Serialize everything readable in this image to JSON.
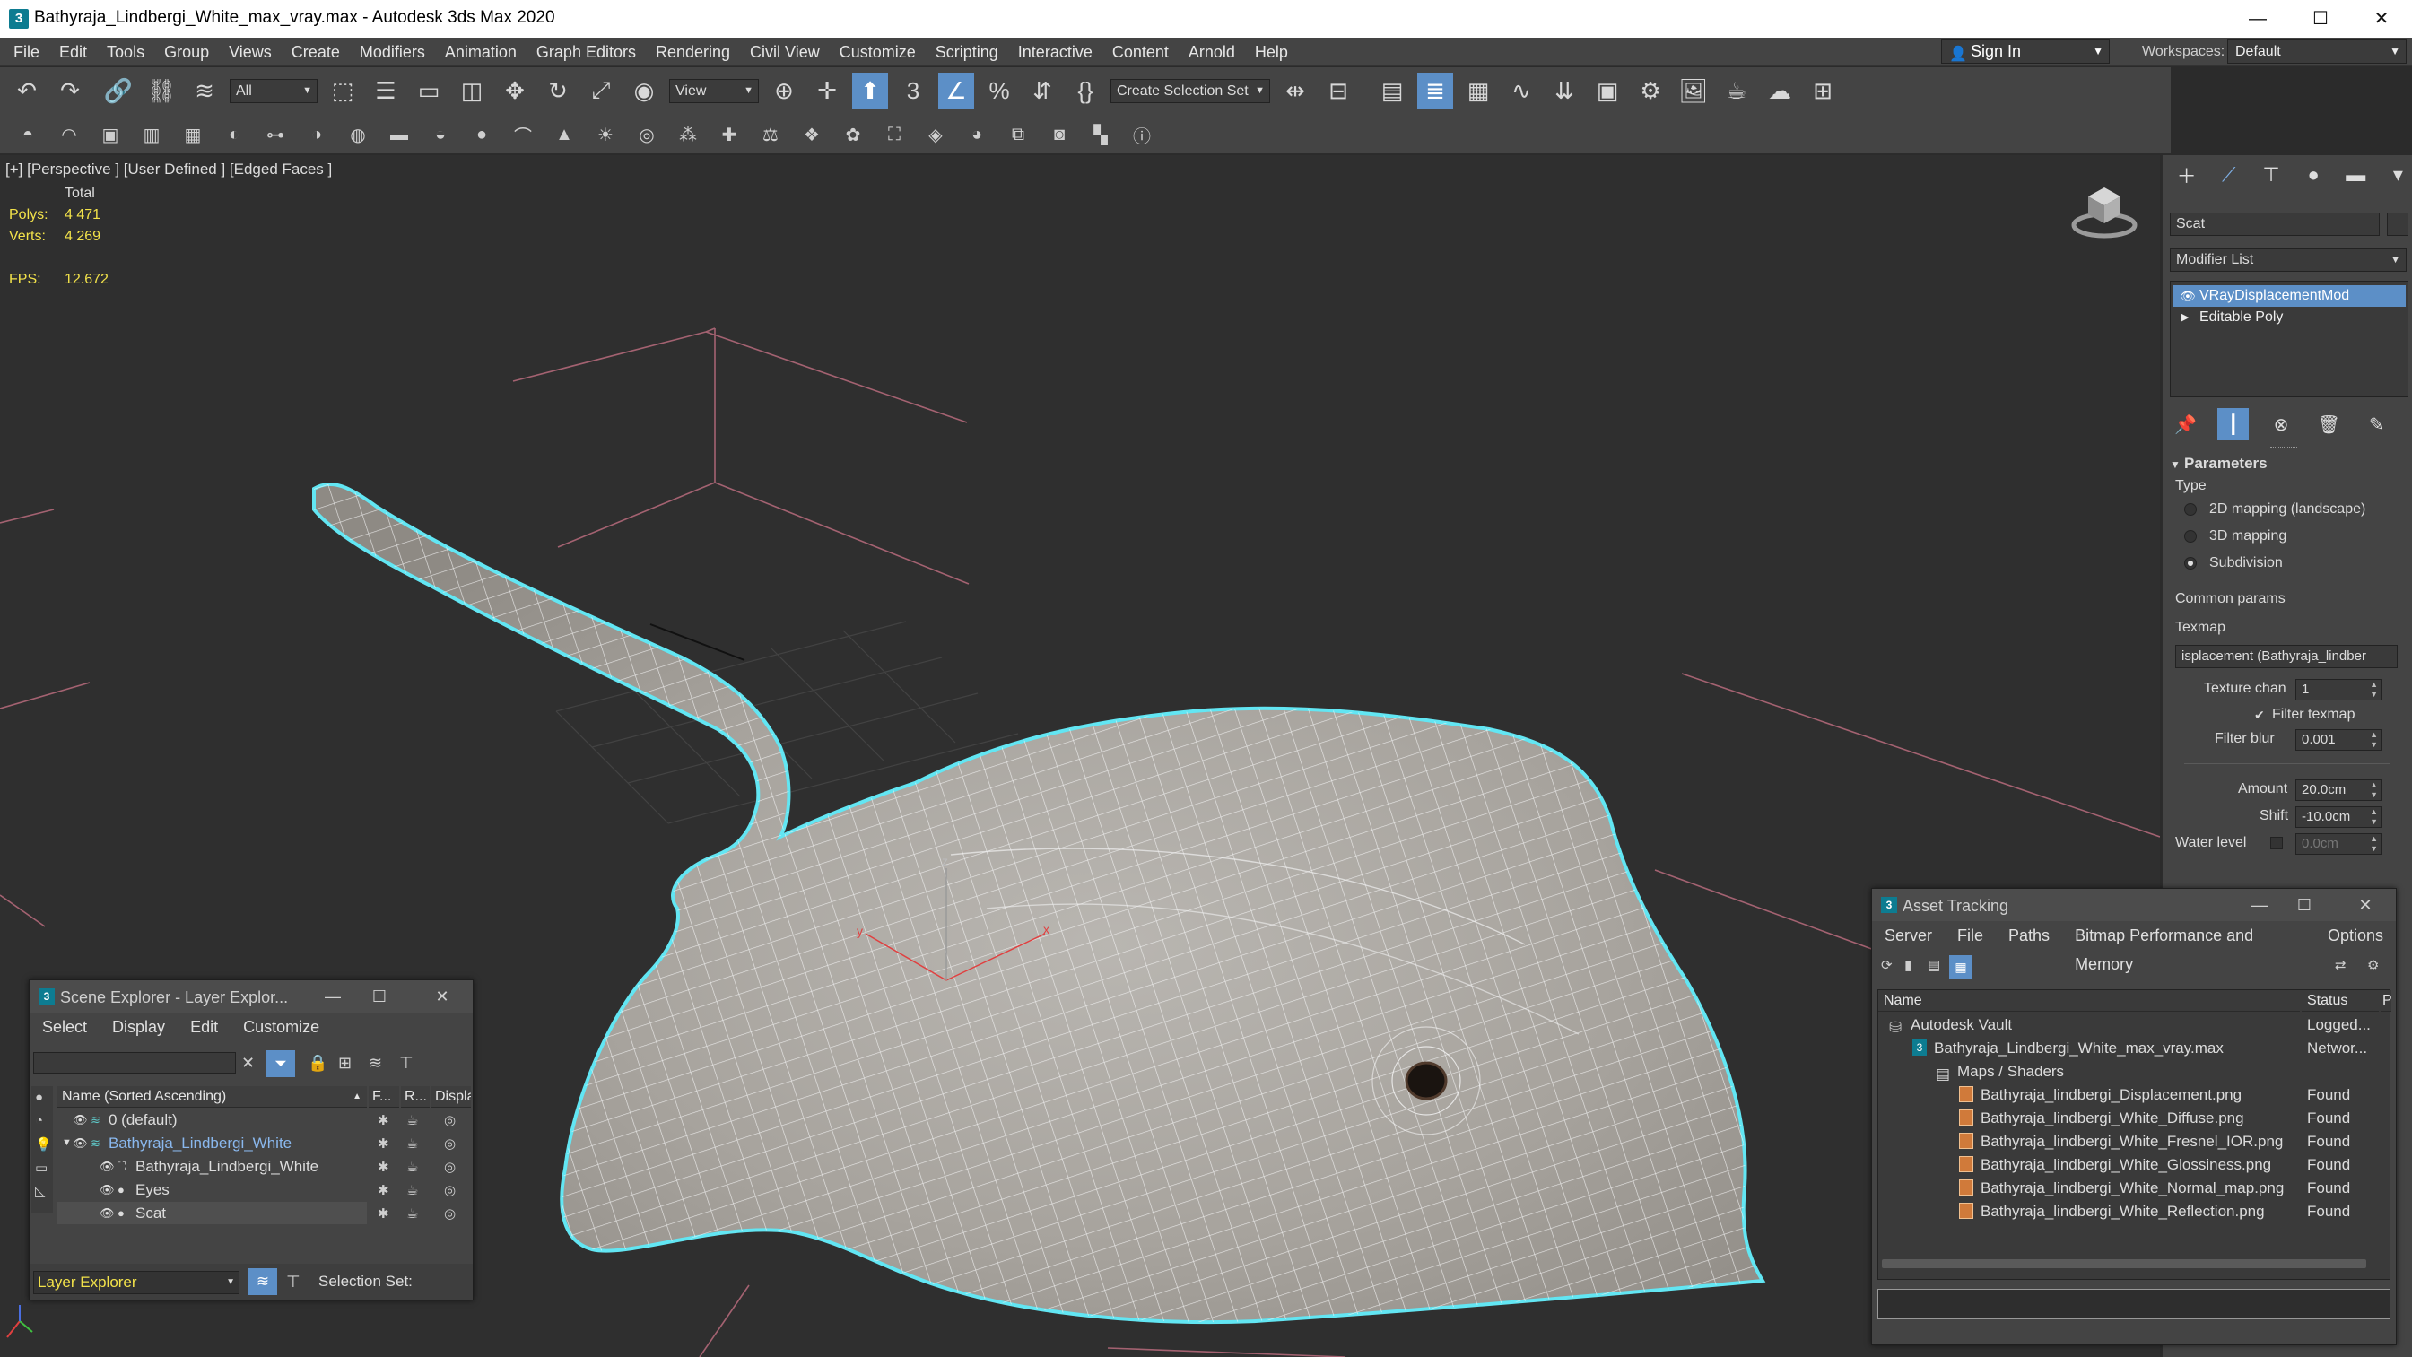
{
  "window": {
    "app_icon": "3",
    "title": "Bathyraja_Lindbergi_White_max_vray.max - Autodesk 3ds Max 2020",
    "minimize": "—",
    "maximize": "☐",
    "close": "✕"
  },
  "menubar": {
    "items": [
      "File",
      "Edit",
      "Tools",
      "Group",
      "Views",
      "Create",
      "Modifiers",
      "Animation",
      "Graph Editors",
      "Rendering",
      "Civil View",
      "Customize",
      "Scripting",
      "Interactive",
      "Content",
      "Arnold",
      "Help"
    ],
    "signin_label": "Sign In",
    "workspaces_label": "Workspaces:",
    "workspace_value": "Default"
  },
  "toolbar": {
    "selection_filter": "All",
    "ref_coord": "View",
    "create_selection_set": "Create Selection Set"
  },
  "viewport": {
    "label": "[+] [Perspective ] [User Defined ] [Edged Faces ]",
    "stats": {
      "header": "Total",
      "polys_label": "Polys:",
      "polys_value": "4 471",
      "verts_label": "Verts:",
      "verts_value": "4 269",
      "fps_label": "FPS:",
      "fps_value": "12.672"
    },
    "gizmo": {
      "x": "x",
      "y": "y",
      "z": "z"
    }
  },
  "command_panel": {
    "object_name": "Scat",
    "modifier_list": "Modifier List",
    "stack": [
      {
        "label": "VRayDisplacementMod",
        "selected": true
      },
      {
        "label": "Editable Poly",
        "selected": false
      }
    ],
    "parameters": {
      "rollout_title": "Parameters",
      "type_label": "Type",
      "type_options": [
        {
          "label": "2D mapping (landscape)",
          "checked": false
        },
        {
          "label": "3D mapping",
          "checked": false
        },
        {
          "label": "Subdivision",
          "checked": true
        }
      ],
      "common_params": "Common params",
      "texmap_label": "Texmap",
      "texmap_value": "isplacement (Bathyraja_lindber",
      "texture_chan_label": "Texture chan",
      "texture_chan_value": "1",
      "filter_texmap_label": "Filter texmap",
      "filter_blur_label": "Filter blur",
      "filter_blur_value": "0.001",
      "amount_label": "Amount",
      "amount_value": "20.0cm",
      "shift_label": "Shift",
      "shift_value": "-10.0cm",
      "water_level_label": "Water level",
      "water_level_value": "0.0cm"
    }
  },
  "scene_explorer": {
    "title": "Scene Explorer - Layer Explor...",
    "menu": [
      "Select",
      "Display",
      "Edit",
      "Customize"
    ],
    "columns": [
      "Name (Sorted Ascending)",
      "F...",
      "R...",
      "Display..."
    ],
    "rows": [
      {
        "name": "0 (default)",
        "level": 0
      },
      {
        "name": "Bathyraja_Lindbergi_White",
        "level": 0
      },
      {
        "name": "Bathyraja_Lindbergi_White",
        "level": 1
      },
      {
        "name": "Eyes",
        "level": 1
      },
      {
        "name": "Scat",
        "level": 1
      }
    ],
    "footer_dropdown": "Layer Explorer",
    "selection_set_label": "Selection Set:"
  },
  "asset_tracking": {
    "title": "Asset Tracking",
    "menu": [
      "Server",
      "File",
      "Paths",
      "Bitmap Performance and Memory",
      "Options"
    ],
    "columns": [
      "Name",
      "Status",
      "P"
    ],
    "rows": [
      {
        "name": "Autodesk Vault",
        "status": "Logged...",
        "level": 0
      },
      {
        "name": "Bathyraja_Lindbergi_White_max_vray.max",
        "status": "Networ...",
        "level": 1
      },
      {
        "name": "Maps / Shaders",
        "status": "",
        "level": 2
      },
      {
        "name": "Bathyraja_lindbergi_Displacement.png",
        "status": "Found",
        "level": 3
      },
      {
        "name": "Bathyraja_lindbergi_White_Diffuse.png",
        "status": "Found",
        "level": 3
      },
      {
        "name": "Bathyraja_lindbergi_White_Fresnel_IOR.png",
        "status": "Found",
        "level": 3
      },
      {
        "name": "Bathyraja_lindbergi_White_Glossiness.png",
        "status": "Found",
        "level": 3
      },
      {
        "name": "Bathyraja_lindbergi_White_Normal_map.png",
        "status": "Found",
        "level": 3
      },
      {
        "name": "Bathyraja_lindbergi_White_Reflection.png",
        "status": "Found",
        "level": 3
      }
    ]
  },
  "colors": {
    "accent": "#5c8fc7",
    "selection_outline": "#5fe0ee",
    "stats_text": "#f2e24a"
  }
}
